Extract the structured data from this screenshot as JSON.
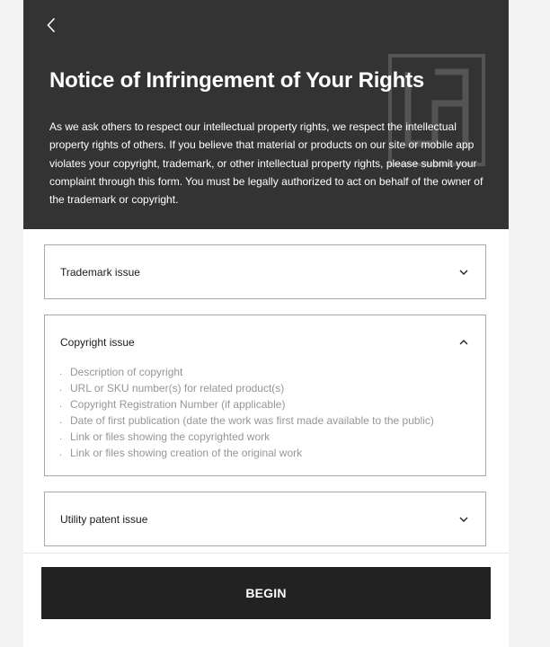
{
  "header": {
    "back_icon": "chevron-left-icon",
    "title": "Notice of Infringement of Your Rights",
    "description": "As we ask others to respect our intellectual property rights, we respect the intellectual property rights of others. If you believe that material or products on our site or mobile app violates your copyright, trademark, or other intellectual property rights, please submit your complaint through this form. You must be legally authorized to act on behalf of the owner of the trademark or copyright.",
    "background_color": "#333333"
  },
  "sections": [
    {
      "title": "Trademark issue",
      "expanded": false,
      "icon": "chevron-down-icon"
    },
    {
      "title": "Copyright issue",
      "expanded": true,
      "icon": "chevron-up-icon",
      "items": [
        "Description of copyright",
        "URL or SKU number(s) for related product(s)",
        "Copyright Registration Number (if applicable)",
        "Date of first publication (date the work was first made available to the public)",
        "Link or files showing the copyrighted work",
        "Link or files showing creation of the original work"
      ]
    },
    {
      "title": "Utility patent issue",
      "expanded": false,
      "icon": "chevron-down-icon"
    }
  ],
  "footer": {
    "begin_label": "BEGIN"
  }
}
